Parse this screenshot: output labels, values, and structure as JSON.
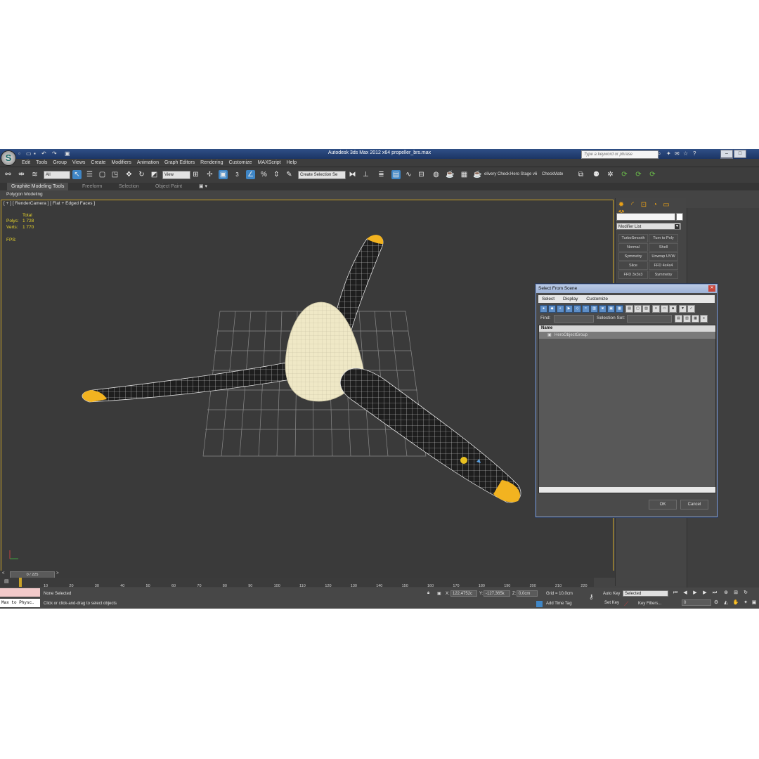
{
  "window": {
    "title": "Autodesk 3ds Max  2012 x64      propeller_brs.max",
    "search_placeholder": "Type a keyword or phrase",
    "logo_text": "S"
  },
  "menu": [
    "Edit",
    "Tools",
    "Group",
    "Views",
    "Create",
    "Modifiers",
    "Animation",
    "Graph Editors",
    "Rendering",
    "Customize",
    "MAXScript",
    "Help"
  ],
  "toolbar": {
    "filter_value": "All",
    "refcoord_value": "View",
    "selection_set": "Create Selection Se",
    "snap_label": "3",
    "script_buttons": [
      "elivery Check",
      "Hero Stage v6",
      "CheckMate"
    ]
  },
  "ribbon": {
    "tabs": [
      "Graphite Modeling Tools",
      "Freeform",
      "Selection",
      "Object Paint"
    ],
    "sub_label": "Polygon Modeling"
  },
  "viewport": {
    "label": "[ + ] [ RenderCamera ] [ Flat + Edged Faces ]",
    "stats_header": "Total",
    "polys_label": "Polys:",
    "polys_value": "1 728",
    "verts_label": "Verts:",
    "verts_value": "1 770",
    "fps_label": "FPS:"
  },
  "command_panel": {
    "modifier_list": "Modifier List",
    "modifiers": [
      "TurboSmooth",
      "Turn to Poly",
      "Normal",
      "Shell",
      "Symmetry",
      "Unwrap UVW",
      "Slice",
      "FFD 4x4x4",
      "FFD 3x3x3",
      "Symmetry"
    ]
  },
  "dialog": {
    "title": "Select From Scene",
    "menu": [
      "Select",
      "Display",
      "Customize"
    ],
    "find_label": "Find:",
    "selection_set_label": "Selection Set:",
    "column_name": "Name",
    "rows": [
      "HeroObjectGroup"
    ],
    "ok": "OK",
    "cancel": "Cancel"
  },
  "timeline": {
    "frame_display": "0 / 225",
    "ticks": [
      "10",
      "20",
      "30",
      "40",
      "50",
      "60",
      "70",
      "80",
      "90",
      "100",
      "110",
      "120",
      "130",
      "140",
      "150",
      "160",
      "170",
      "180",
      "190",
      "200",
      "210",
      "220"
    ]
  },
  "status": {
    "maxscript": "Max to Physc.",
    "selection": "None Selected",
    "prompt": "Click or click-and-drag to select objects",
    "x_label": "X:",
    "x_value": "122,4752c",
    "y_label": "Y:",
    "y_value": "-127,365k",
    "z_label": "Z:",
    "z_value": "0,0cm",
    "grid": "Grid = 10,0cm",
    "add_time_tag": "Add Time Tag",
    "auto_key": "Auto Key",
    "set_key": "Set Key",
    "key_mode": "Selected",
    "key_filters": "Key Filters...",
    "frame": "0"
  },
  "colors": {
    "title_bar": "#2f4f86",
    "viewport_border": "#c9a227",
    "blade_tip": "#f2b320",
    "spinner": "#efe8c6",
    "accent_blue": "#3f86c6"
  }
}
